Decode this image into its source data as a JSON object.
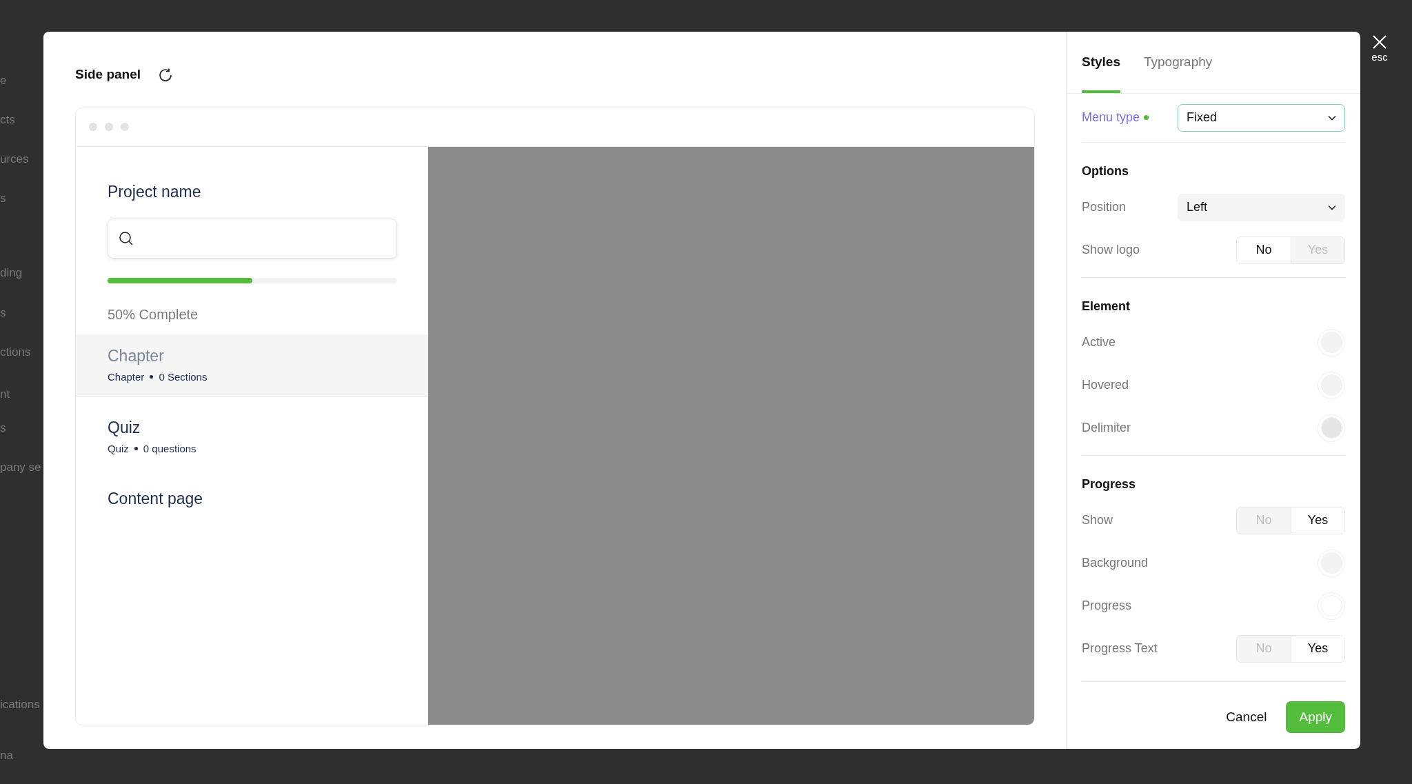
{
  "background_sidebar": [
    "e",
    "cts",
    "urces",
    "s",
    "ding",
    "s",
    "ctions",
    "nt",
    "s",
    "pany se",
    "ications",
    "na"
  ],
  "preview": {
    "title": "Side panel",
    "project_name": "Project name",
    "progress": {
      "level": 0.5,
      "text": "50% Complete"
    },
    "items": [
      {
        "title": "Chapter",
        "meta": [
          "Chapter",
          "0 Sections"
        ],
        "selected": true
      },
      {
        "title": "Quiz",
        "meta": [
          "Quiz",
          "0 questions"
        ],
        "selected": false
      },
      {
        "title": "Content page",
        "selected": false
      }
    ]
  },
  "tabs": [
    {
      "label": "Styles",
      "selected": true
    },
    {
      "label": "Typography",
      "selected": false
    }
  ],
  "menu_type": {
    "label": "Menu type",
    "value": "Fixed",
    "modified": true
  },
  "sections": [
    {
      "title": "Options",
      "rows": [
        {
          "kind": "select",
          "label": "Position",
          "value": "Left"
        },
        {
          "kind": "toggle",
          "label": "Show logo",
          "options": [
            {
              "label": "No",
              "selected": true
            },
            {
              "label": "Yes",
              "selected": false
            }
          ]
        }
      ]
    },
    {
      "title": "Element",
      "rows": [
        {
          "kind": "color",
          "label": "Active",
          "color": "#f3f3f3"
        },
        {
          "kind": "color",
          "label": "Hovered",
          "color": "#f3f3f3"
        },
        {
          "kind": "color",
          "label": "Delimiter",
          "color": "#e6e6e6"
        }
      ]
    },
    {
      "title": "Progress",
      "rows": [
        {
          "kind": "toggle",
          "label": "Show",
          "options": [
            {
              "label": "No",
              "selected": false
            },
            {
              "label": "Yes",
              "selected": true
            }
          ]
        },
        {
          "kind": "color",
          "label": "Background",
          "color": "#f3f3f3"
        },
        {
          "kind": "color",
          "label": "Progress",
          "color": "#ffffff"
        },
        {
          "kind": "toggle",
          "label": "Progress Text",
          "options": [
            {
              "label": "No",
              "selected": false
            },
            {
              "label": "Yes",
              "selected": true
            }
          ]
        }
      ]
    }
  ],
  "buttons": {
    "cancel": "Cancel",
    "apply": "Apply"
  },
  "close": {
    "label": "esc"
  }
}
